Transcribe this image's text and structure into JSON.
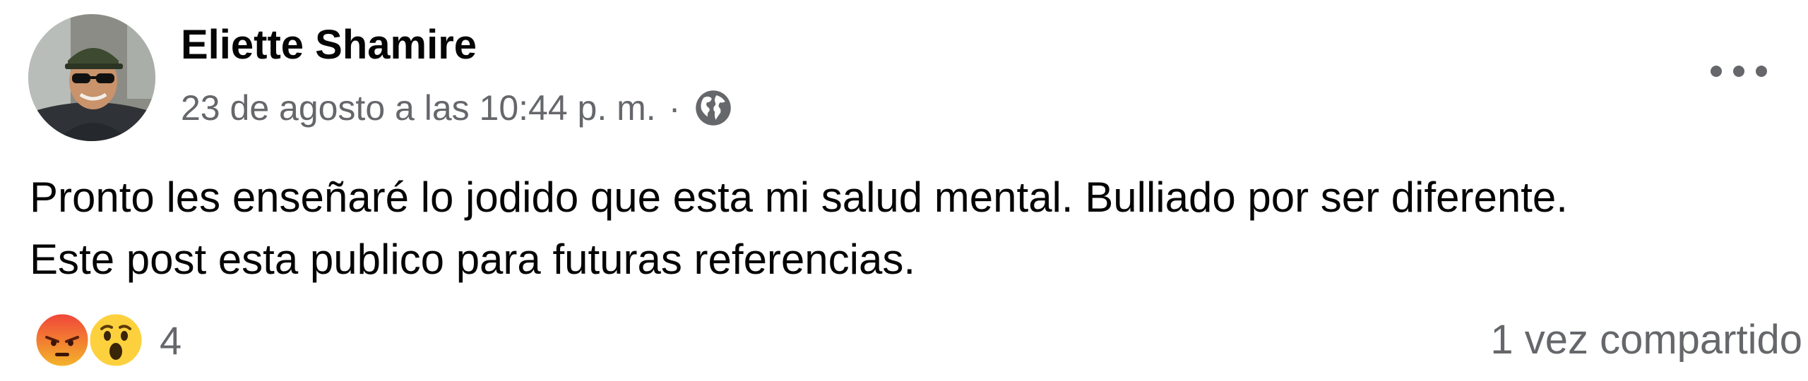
{
  "post": {
    "author": {
      "name": "Eliette Shamire",
      "avatar_icon": "profile-photo"
    },
    "timestamp": "23 de agosto a las 10:44 p. m.",
    "separator": "·",
    "privacy_icon": "globe-icon",
    "more_icon": "more-options-icon",
    "body_lines": [
      "Pronto les enseñaré lo jodido que esta mi salud mental. Bulliado por ser diferente.",
      "Este post esta publico para futuras referencias."
    ],
    "reactions": {
      "icons": [
        "angry-reaction-icon",
        "wow-reaction-icon"
      ],
      "count": "4"
    },
    "share_count": "1 vez compartido"
  },
  "colors": {
    "text_primary": "#050505",
    "text_secondary": "#65676b",
    "angry_top": "#f0443a",
    "angry_bottom": "#f4b52a",
    "wow_face": "#fcd13d"
  }
}
